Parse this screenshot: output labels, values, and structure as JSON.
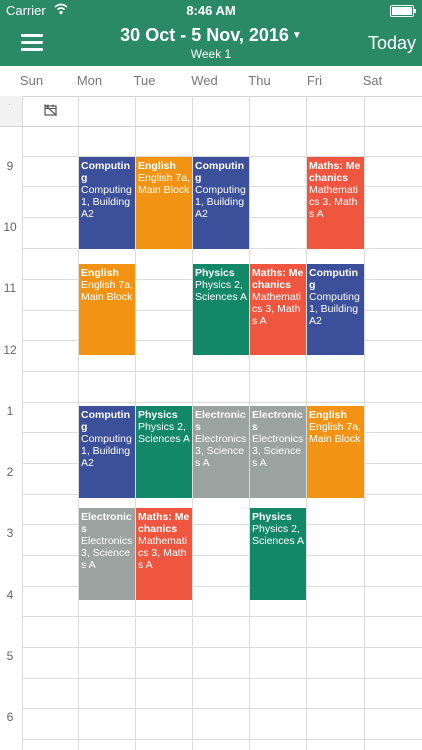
{
  "status_bar": {
    "carrier": "Carrier",
    "time": "8:46 AM"
  },
  "nav": {
    "date_range": "30 Oct - 5 Nov, 2016",
    "week_label": "Week 1",
    "today_label": "Today"
  },
  "days": [
    "Sun",
    "Mon",
    "Tue",
    "Wed",
    "Thu",
    "Fri",
    "Sat"
  ],
  "hours": [
    "9",
    "10",
    "11",
    "12",
    "1",
    "2",
    "3",
    "4",
    "5",
    "6"
  ],
  "events": {
    "mon_9": {
      "title": "Computing",
      "location": "Computing 1, Building A2"
    },
    "tue_9": {
      "title": "English",
      "location": "English 7a, Main Block"
    },
    "wed_9": {
      "title": "Computing",
      "location": "Computing 1, Building A2"
    },
    "fri_9": {
      "title": "Maths: Mechanics",
      "location": "Mathematics 3, Maths A"
    },
    "mon_11": {
      "title": "English",
      "location": "English 7a, Main Block"
    },
    "wed_11": {
      "title": "Physics",
      "location": "Physics 2, Sciences A"
    },
    "thu_11": {
      "title": "Maths: Mechanics",
      "location": "Mathematics 3, Maths A"
    },
    "fri_11": {
      "title": "Computing",
      "location": "Computing 1, Building A2"
    },
    "mon_1": {
      "title": "Computing",
      "location": "Computing 1, Building A2"
    },
    "tue_1": {
      "title": "Physics",
      "location": "Physics 2, Sciences A"
    },
    "wed_1": {
      "title": "Electronics",
      "location": "Electronics 3, Sciences A"
    },
    "thu_1": {
      "title": "Electronics",
      "location": "Electronics 3, Sciences A"
    },
    "fri_1": {
      "title": "English",
      "location": "English 7a, Main Block"
    },
    "mon_3": {
      "title": "Electronics",
      "location": "Electronics 3, Sciences A"
    },
    "tue_3": {
      "title": "Maths: Mechanics",
      "location": "Mathematics 3, Maths A"
    },
    "thu_3": {
      "title": "Physics",
      "location": "Physics 2, Sciences A"
    }
  },
  "colors": {
    "header": "#2a8a67",
    "computing": "#3b4f9a",
    "english": "#f39314",
    "maths": "#ee5640",
    "physics": "#138868",
    "electronics": "#9aa39f"
  },
  "icons": {
    "menu": "hamburger-menu-icon",
    "dropdown": "caret-down-icon",
    "all_day": "calendar-off-icon",
    "wifi": "wifi-icon",
    "battery": "battery-icon"
  }
}
